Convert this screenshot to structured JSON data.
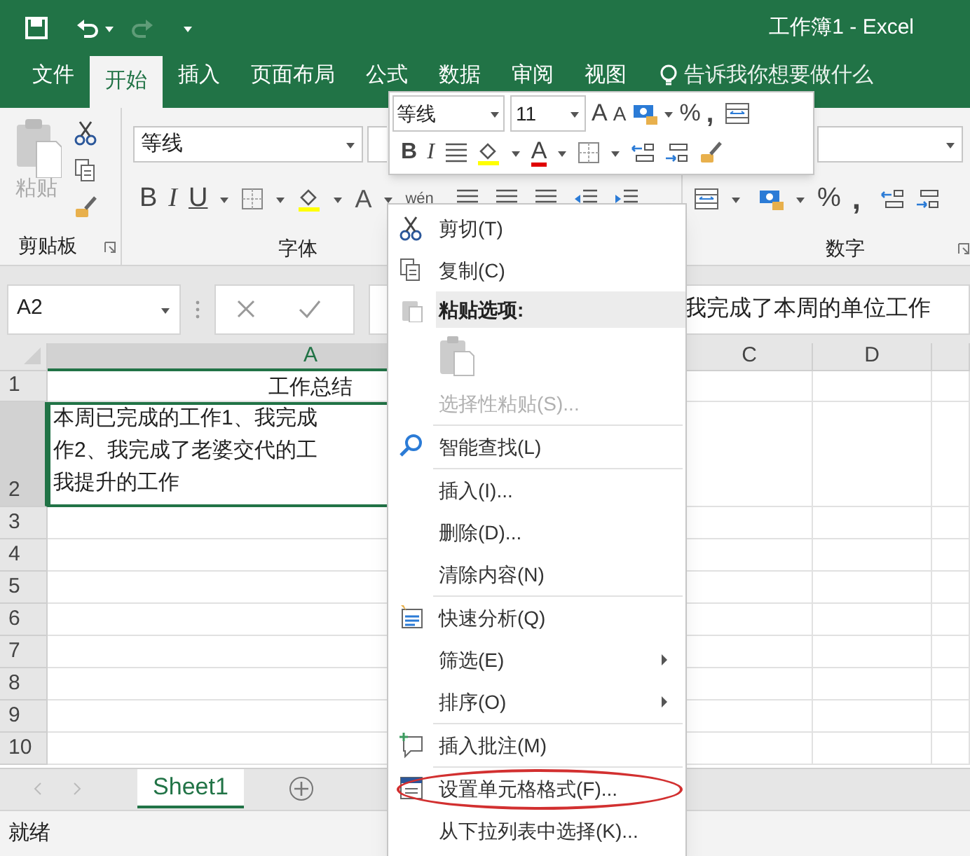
{
  "title_bar": {
    "title": "工作簿1  -  Excel"
  },
  "ribbon_tabs": [
    {
      "label": "文件",
      "selected": false
    },
    {
      "label": "开始",
      "selected": true
    },
    {
      "label": "插入",
      "selected": false
    },
    {
      "label": "页面布局",
      "selected": false
    },
    {
      "label": "公式",
      "selected": false
    },
    {
      "label": "数据",
      "selected": false
    },
    {
      "label": "审阅",
      "selected": false
    },
    {
      "label": "视图",
      "selected": false
    }
  ],
  "tell_me": {
    "placeholder": "告诉我你想要做什么"
  },
  "ribbon": {
    "paste_label": "粘贴",
    "font_name": "等线",
    "font_buttons": [
      "B",
      "I",
      "U"
    ],
    "font_color_glyph": "A",
    "phonetic_glyph": "wén",
    "number_buttons": [
      "%",
      ","
    ],
    "groups": [
      {
        "label": "剪贴板"
      },
      {
        "label": "字体"
      },
      {
        "label": "数字"
      }
    ]
  },
  "mini_toolbar": {
    "font": "等线",
    "size": "11",
    "grow_glyph": "A",
    "shrink_glyph": "A",
    "percent": "%",
    "comma": ",",
    "bold": "B",
    "italic": "I",
    "font_color_glyph": "A"
  },
  "formula_bar": {
    "name_box": "A2",
    "content": "我完成了本周的单位工作"
  },
  "sheet": {
    "columns": [
      {
        "label": "A",
        "selected": true
      },
      {
        "label": "C",
        "selected": false
      },
      {
        "label": "D",
        "selected": false
      }
    ],
    "rows": [
      {
        "label": "1",
        "selected": false,
        "kind": "heading",
        "lines": [
          "工作总结"
        ]
      },
      {
        "label": "2",
        "selected": true,
        "kind": "wrapped",
        "lines": [
          "本周已完成的工作1、我完成",
          "作2、我完成了老婆交代的工",
          "我提升的工作"
        ]
      },
      {
        "label": "3",
        "selected": false
      },
      {
        "label": "4",
        "selected": false
      },
      {
        "label": "5",
        "selected": false
      },
      {
        "label": "6",
        "selected": false
      },
      {
        "label": "7",
        "selected": false
      },
      {
        "label": "8",
        "selected": false
      },
      {
        "label": "9",
        "selected": false
      },
      {
        "label": "10",
        "selected": false
      }
    ]
  },
  "context_menu": [
    {
      "kind": "item",
      "label": "剪切(T)"
    },
    {
      "kind": "item",
      "label": "复制(C)"
    },
    {
      "kind": "header",
      "label": "粘贴选项:"
    },
    {
      "kind": "paste_icons"
    },
    {
      "kind": "item",
      "label": "选择性粘贴(S)...",
      "disabled": true
    },
    {
      "kind": "separator"
    },
    {
      "kind": "item",
      "label": "智能查找(L)"
    },
    {
      "kind": "separator"
    },
    {
      "kind": "item",
      "label": "插入(I)..."
    },
    {
      "kind": "item",
      "label": "删除(D)..."
    },
    {
      "kind": "item",
      "label": "清除内容(N)"
    },
    {
      "kind": "separator"
    },
    {
      "kind": "item",
      "label": "快速分析(Q)"
    },
    {
      "kind": "item",
      "label": "筛选(E)",
      "submenu": true
    },
    {
      "kind": "item",
      "label": "排序(O)",
      "submenu": true
    },
    {
      "kind": "separator"
    },
    {
      "kind": "item",
      "label": "插入批注(M)"
    },
    {
      "kind": "separator"
    },
    {
      "kind": "item",
      "label": "设置单元格格式(F)...",
      "circled": true
    },
    {
      "kind": "item",
      "label": "从下拉列表中选择(K)..."
    }
  ],
  "sheet_tabs": [
    {
      "label": "Sheet1",
      "selected": true
    }
  ],
  "status_bar": {
    "text": "就绪"
  }
}
